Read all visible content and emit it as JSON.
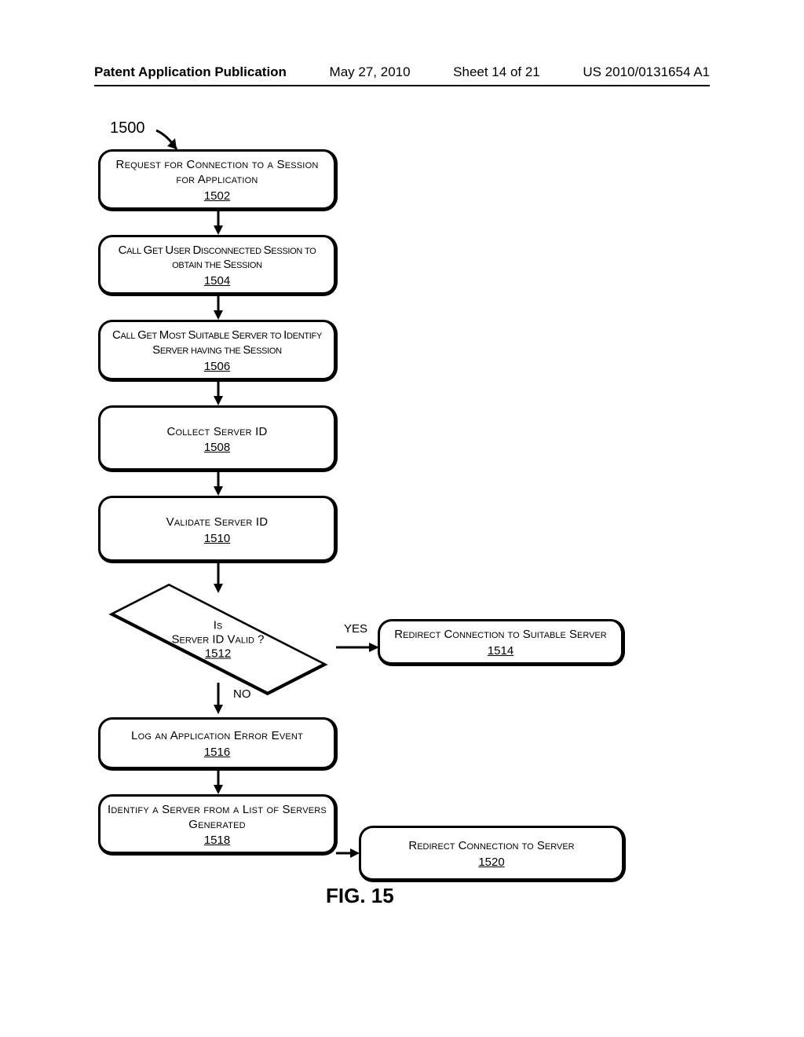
{
  "header": {
    "publication": "Patent Application Publication",
    "date": "May 27, 2010",
    "sheet": "Sheet 14 of 21",
    "pubno": "US 2010/0131654 A1"
  },
  "refLabel": "1500",
  "boxes": {
    "b1502": {
      "text": "Request for Connection to a Session for Application",
      "ref": "1502"
    },
    "b1504": {
      "text": "Call Get User Disconnected Session to obtain the Session",
      "ref": "1504"
    },
    "b1506": {
      "text": "Call Get Most Suitable Server to Identify Server having the Session",
      "ref": "1506"
    },
    "b1508": {
      "text": "Collect Server ID",
      "ref": "1508"
    },
    "b1510": {
      "text": "Validate Server ID",
      "ref": "1510"
    },
    "d1512": {
      "line1": "Is",
      "line2": "Server ID Valid ?",
      "ref": "1512"
    },
    "b1514": {
      "text": "Redirect Connection to Suitable Server",
      "ref": "1514"
    },
    "b1516": {
      "text": "Log an Application Error Event",
      "ref": "1516"
    },
    "b1518": {
      "text": "Identify a Server from a List of Servers Generated",
      "ref": "1518"
    },
    "b1520": {
      "text": "Redirect Connection to Server",
      "ref": "1520"
    }
  },
  "branches": {
    "yes": "YES",
    "no": "NO"
  },
  "figure": "FIG. 15"
}
